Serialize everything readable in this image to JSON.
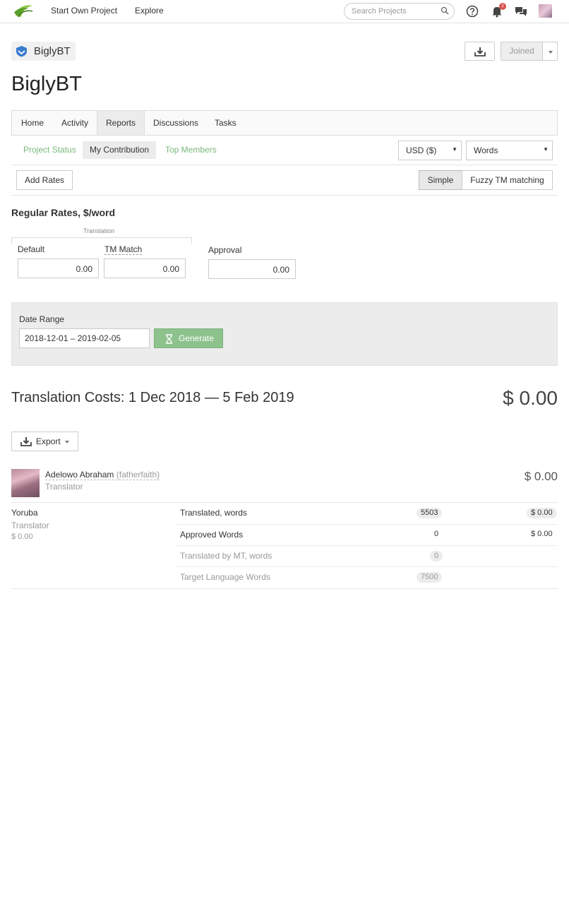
{
  "topbar": {
    "nav": [
      "Start Own Project",
      "Explore"
    ],
    "search_placeholder": "Search Projects",
    "notification_count": "1",
    "colors": {
      "accent_green": "#7ab87a",
      "badge_red": "#d9534f"
    }
  },
  "project": {
    "chip_label": "BiglyBT",
    "title": "BiglyBT",
    "joined_label": "Joined"
  },
  "tabs": [
    "Home",
    "Activity",
    "Reports",
    "Discussions",
    "Tasks"
  ],
  "active_tab": "Reports",
  "subtabs": [
    "Project Status",
    "My Contribution",
    "Top Members"
  ],
  "active_subtab": "My Contribution",
  "selects": {
    "currency": "USD ($)",
    "unit": "Words"
  },
  "toolbar": {
    "add_rates": "Add Rates",
    "simple": "Simple",
    "fuzzy": "Fuzzy TM matching"
  },
  "rates": {
    "title": "Regular Rates, $/word",
    "group_label": "Translation",
    "default_label": "Default",
    "default_value": "0.00",
    "tm_label": "TM Match",
    "tm_value": "0.00",
    "approval_label": "Approval",
    "approval_value": "0.00"
  },
  "date_range": {
    "label": "Date Range",
    "value": "2018-12-01 – 2019-02-05",
    "generate": "Generate"
  },
  "costs": {
    "title": "Translation Costs: 1 Dec 2018 — 5 Feb 2019",
    "total": "$ 0.00",
    "export": "Export"
  },
  "member": {
    "name": "Adelowo Abraham",
    "handle": "(fatherfaith)",
    "role": "Translator",
    "total": "$ 0.00",
    "language": "Yoruba",
    "language_role": "Translator",
    "language_cost": "$ 0.00",
    "rows": [
      {
        "label": "Translated, words",
        "value": "5503",
        "cost": "$ 0.00"
      },
      {
        "label": "Approved Words",
        "value": "0",
        "cost": "$ 0.00"
      },
      {
        "label": "Translated by MT, words",
        "value": "0",
        "cost": ""
      },
      {
        "label": "Target Language Words",
        "value": "7500",
        "cost": ""
      }
    ]
  }
}
